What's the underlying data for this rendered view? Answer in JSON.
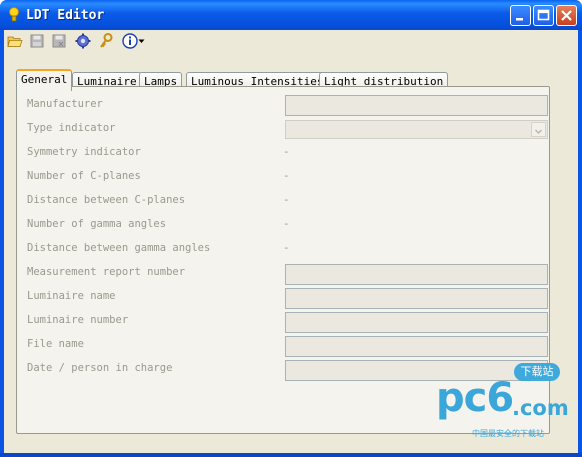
{
  "window": {
    "title": "LDT Editor"
  },
  "toolbar": {
    "icons": [
      "open-folder-icon",
      "save-icon",
      "save-as-icon",
      "settings-gear-icon",
      "key-icon",
      "info-icon",
      "dropdown-arrow-icon"
    ]
  },
  "tabs": [
    {
      "label": "General",
      "active": true
    },
    {
      "label": "Luminaire",
      "active": false
    },
    {
      "label": "Lamps",
      "active": false
    },
    {
      "label": "Luminous Intensities",
      "active": false
    },
    {
      "label": "Light distribution",
      "active": false
    }
  ],
  "general": {
    "manufacturer_label": "Manufacturer",
    "manufacturer_value": "",
    "type_indicator_label": "Type indicator",
    "type_indicator_value": "",
    "symmetry_indicator_label": "Symmetry indicator",
    "symmetry_indicator_value": "-",
    "num_c_planes_label": "Number of C-planes",
    "num_c_planes_value": "-",
    "distance_c_planes_label": "Distance between C-planes",
    "distance_c_planes_value": "-",
    "num_gamma_label": "Number of gamma angles",
    "num_gamma_value": "-",
    "distance_gamma_label": "Distance between gamma angles",
    "distance_gamma_value": "-",
    "report_number_label": "Measurement report number",
    "report_number_value": "",
    "luminaire_name_label": "Luminaire name",
    "luminaire_name_value": "",
    "luminaire_number_label": "Luminaire number",
    "luminaire_number_value": "",
    "file_name_label": "File name",
    "file_name_value": "",
    "date_person_label": "Date / person in charge",
    "date_person_value": ""
  },
  "watermark": {
    "main": "pc6",
    "com": ".com",
    "badge": "下载站",
    "sub": "中国最安全的下载站"
  },
  "colors": {
    "titlebar": "#0a5ae8",
    "client": "#ece9d8",
    "label": "#9a998c",
    "tab_accent": "#f6a623",
    "watermark": "#3aa6d9"
  }
}
